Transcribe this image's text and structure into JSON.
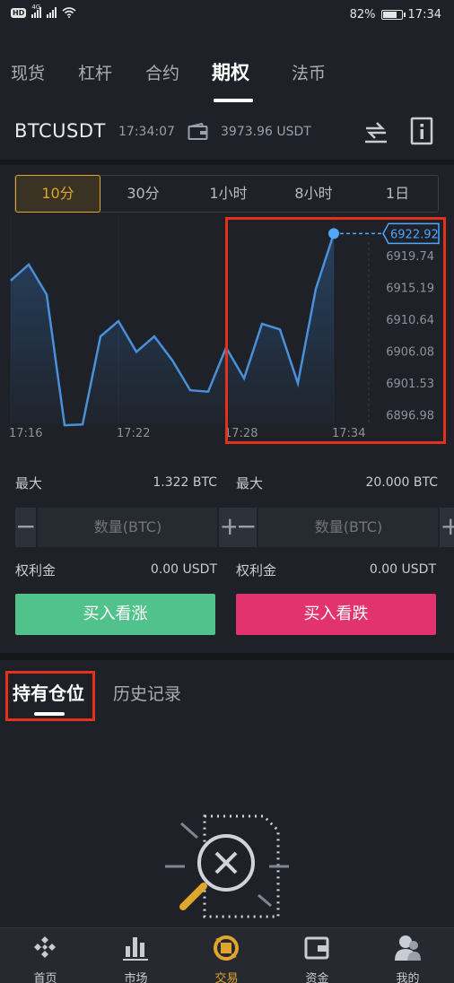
{
  "status_bar": {
    "network": "4G",
    "battery": "82%",
    "battery_level": 0.82,
    "time": "17:34"
  },
  "top_tabs": [
    "现货",
    "杠杆",
    "合约",
    "期权",
    "法币"
  ],
  "active_top_tab": "期权",
  "symbol": {
    "name": "BTCUSDT",
    "time": "17:34:07",
    "balance": "3973.96 USDT"
  },
  "intervals": [
    "10分",
    "30分",
    "1小时",
    "8小时",
    "1日"
  ],
  "active_interval": "10分",
  "chart_data": {
    "type": "line",
    "x_ticks": [
      "17:16",
      "17:22",
      "17:28",
      "17:34"
    ],
    "y_ticks": [
      "6919.74",
      "6915.19",
      "6910.64",
      "6906.08",
      "6901.53",
      "6896.98"
    ],
    "current_price": "6922.92",
    "x_range": [
      "17:16",
      "17:36"
    ],
    "y_range": [
      6895,
      6924
    ],
    "series": [
      {
        "points": [
          [
            "17:16",
            6916.2
          ],
          [
            "17:17",
            6918.5
          ],
          [
            "17:18",
            6914.2
          ],
          [
            "17:19",
            6895.5
          ],
          [
            "17:20",
            6895.6
          ],
          [
            "17:21",
            6908.2
          ],
          [
            "17:22",
            6910.4
          ],
          [
            "17:23",
            6906.0
          ],
          [
            "17:24",
            6908.2
          ],
          [
            "17:25",
            6904.8
          ],
          [
            "17:26",
            6900.5
          ],
          [
            "17:27",
            6900.3
          ],
          [
            "17:28",
            6906.6
          ],
          [
            "17:29",
            6902.2
          ],
          [
            "17:30",
            6910.0
          ],
          [
            "17:31",
            6909.2
          ],
          [
            "17:32",
            6901.5
          ],
          [
            "17:33",
            6915.0
          ],
          [
            "17:34",
            6922.9
          ]
        ]
      }
    ],
    "colors": {
      "line": "#4a90d9",
      "current_price": "#4ea6ff"
    }
  },
  "trade": {
    "call": {
      "max_label": "最大",
      "max_value": "1.322 BTC",
      "qty_placeholder": "数量(BTC)",
      "premium_label": "权利金",
      "premium_value": "0.00 USDT",
      "button": "买入看涨",
      "color": "#52c28c"
    },
    "put": {
      "max_label": "最大",
      "max_value": "20.000 BTC",
      "qty_placeholder": "数量(BTC)",
      "premium_label": "权利金",
      "premium_value": "0.00 USDT",
      "button": "买入看跌",
      "color": "#e2336f"
    },
    "minus": "−",
    "plus": "+"
  },
  "positions": {
    "tabs": [
      "持有仓位",
      "历史记录"
    ],
    "active": "持有仓位"
  },
  "bottom_nav": [
    {
      "label": "首页",
      "icon": "home-icon"
    },
    {
      "label": "市场",
      "icon": "market-icon"
    },
    {
      "label": "交易",
      "icon": "trade-icon"
    },
    {
      "label": "资金",
      "icon": "wallet-icon"
    },
    {
      "label": "我的",
      "icon": "user-icon"
    }
  ],
  "bottom_nav_active": "交易",
  "accent_color": "#e0a52c",
  "highlight_color": "#e5301b"
}
